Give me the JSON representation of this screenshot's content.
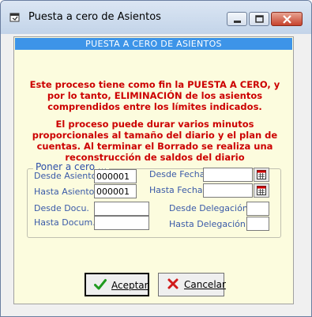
{
  "window": {
    "title": "Puesta a cero de Asientos"
  },
  "panel": {
    "header": "PUESTA A CERO DE ASIENTOS",
    "message1": "Este proceso tiene como fin la PUESTA A CERO, y por lo tanto, ELIMINACIÓN de los asientos comprendidos entre los límites indicados.",
    "message2": "El proceso puede durar varios minutos proporcionales al tamaño del diario y el plan de cuentas. Al terminar el Borrado se realiza una reconstrucción de saldos del diario"
  },
  "group": {
    "legend": "Poner a cero ...",
    "desde_asiento_label": "Desde Asiento",
    "desde_asiento_value": "000001",
    "hasta_asiento_label": "Hasta Asiento",
    "hasta_asiento_value": "000001",
    "desde_fecha_label": "Desde Fecha",
    "desde_fecha_value": "",
    "hasta_fecha_label": "Hasta Fecha",
    "hasta_fecha_value": "",
    "desde_docu_label": "Desde Docu.",
    "desde_docu_value": "",
    "hasta_docum_label": "Hasta Docum.",
    "hasta_docum_value": "",
    "desde_delegacion_label": "Desde Delegación",
    "desde_delegacion_value": "",
    "hasta_delegacion_label": "Hasta Delegación",
    "hasta_delegacion_value": ""
  },
  "buttons": {
    "accept_label": "Aceptar",
    "accept_icon": "checkmark-icon",
    "cancel_label": "Cancelar",
    "cancel_icon": "x-icon"
  },
  "colors": {
    "header_bar": "#3d94e8",
    "panel_bg": "#fcfcde",
    "message_text": "#cc0000",
    "label_text": "#3a5aa8"
  }
}
